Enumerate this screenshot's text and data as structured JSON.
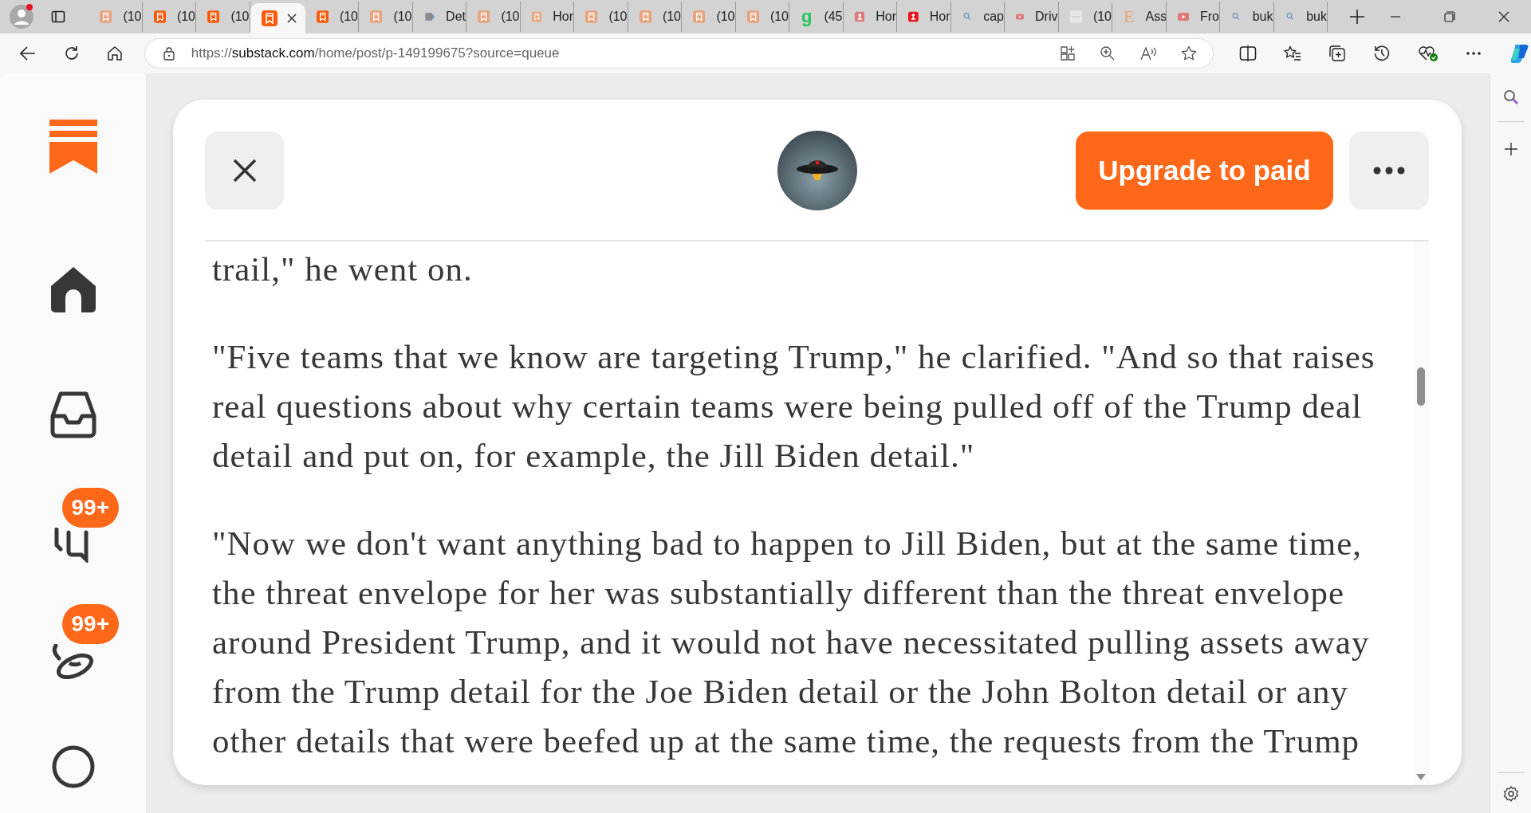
{
  "tabs": [
    {
      "kind": "substack-faded",
      "label": "(10",
      "selected": false
    },
    {
      "kind": "substack",
      "label": "(10",
      "selected": false
    },
    {
      "kind": "substack",
      "label": "(10",
      "selected": false
    },
    {
      "kind": "substack",
      "selected": true
    },
    {
      "kind": "substack",
      "label": "(10",
      "selected": false
    },
    {
      "kind": "substack-faded",
      "label": "(10",
      "selected": false
    },
    {
      "kind": "arrow",
      "label": "Det",
      "selected": false
    },
    {
      "kind": "substack-faded",
      "label": "(10",
      "selected": false
    },
    {
      "kind": "substack-faded",
      "label": "Hor",
      "selected": false
    },
    {
      "kind": "substack-faded",
      "label": "(10",
      "selected": false
    },
    {
      "kind": "substack-faded",
      "label": "(10",
      "selected": false
    },
    {
      "kind": "substack-faded",
      "label": "(10",
      "selected": false
    },
    {
      "kind": "substack-faded",
      "label": "(10",
      "selected": false
    },
    {
      "kind": "letter",
      "glyph": "g",
      "label": "(45",
      "selected": false
    },
    {
      "kind": "person-pink",
      "label": "Hor",
      "selected": false
    },
    {
      "kind": "person-red",
      "label": "Hor",
      "selected": false
    },
    {
      "kind": "search",
      "label": "cap",
      "selected": false
    },
    {
      "kind": "video",
      "label": "Driv",
      "selected": false
    },
    {
      "kind": "thumbnail",
      "label": "(10",
      "selected": false
    },
    {
      "kind": "letter-serif",
      "glyph": "E",
      "label": "Ass",
      "selected": false
    },
    {
      "kind": "video",
      "label": "Fro",
      "selected": false
    },
    {
      "kind": "search",
      "label": "buk",
      "selected": false
    },
    {
      "kind": "search",
      "label": "buk",
      "selected": false
    }
  ],
  "address": {
    "scheme": "https://",
    "host": "substack.com",
    "path": "/home/post/p-149199675?source=queue"
  },
  "sidebar": [
    {
      "kind": "home"
    },
    {
      "kind": "inbox"
    },
    {
      "kind": "chat",
      "badge": "99+"
    },
    {
      "kind": "activity",
      "badge": "99+"
    },
    {
      "kind": "profile"
    }
  ],
  "header": {
    "upgrade_button": "Upgrade to paid"
  },
  "article": {
    "paragraphs": [
      "trail,\" he went on.",
      "\"Five teams that we know are targeting Trump,\" he clarified. \"And so that raises real questions about why certain teams were being pulled off of the Trump deal detail and put on, for example, the Jill Biden detail.\"",
      "\"Now we don't want anything bad to happen to Jill Biden, but at the same time, the threat envelope for her was substantially different than the threat envelope around President Trump, and it would not have necessitated pulling assets away from the Trump detail for the Joe Biden detail or the John Bolton detail or any other details that were beefed up at the same time, the requests from the Trump"
    ]
  }
}
